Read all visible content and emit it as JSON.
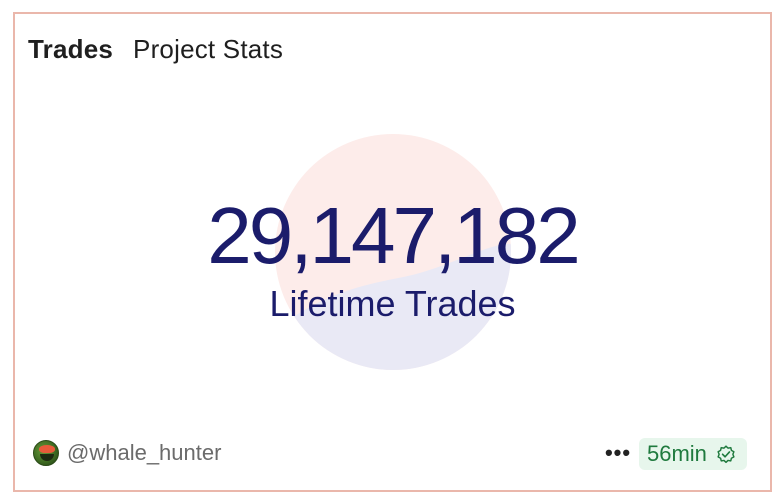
{
  "card": {
    "tabs": [
      {
        "label": "Trades"
      },
      {
        "label": "Project Stats"
      }
    ],
    "stat": {
      "value": "29,147,182",
      "label": "Lifetime Trades"
    },
    "author": {
      "username": "@whale_hunter",
      "avatar_icon": "frog-avatar"
    },
    "more_icon": "•••",
    "badge": {
      "text": "56min",
      "icon": "verified-check-icon",
      "color": "#1f7a3e"
    },
    "colors": {
      "border": "#eab7ab",
      "stat_text": "#1b1c6b",
      "circle_top": "#fdecea",
      "circle_bottom": "#e9e9f5"
    }
  }
}
